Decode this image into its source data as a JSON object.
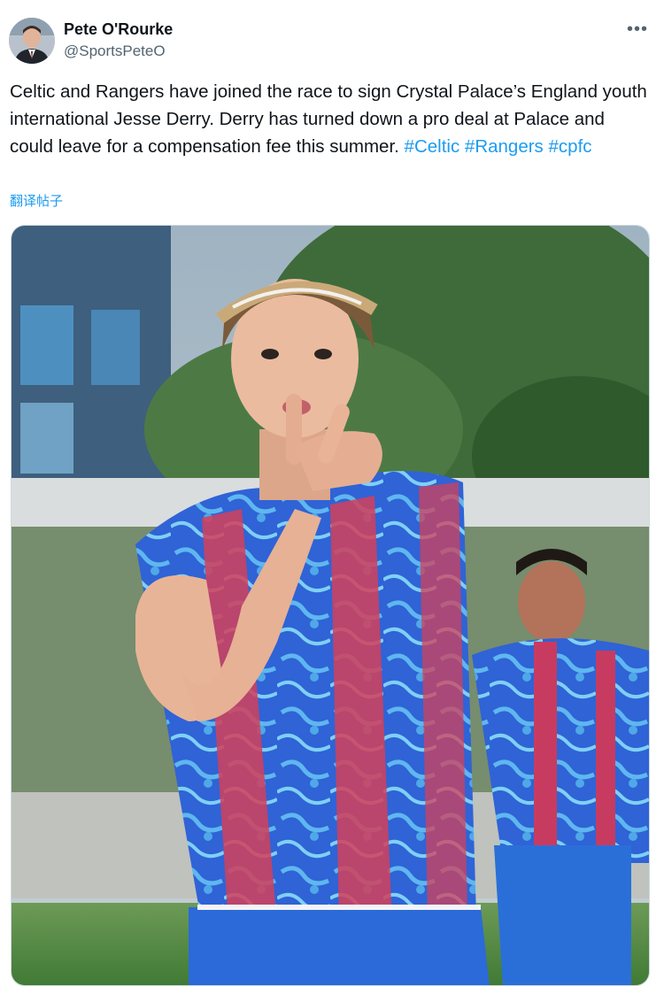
{
  "author": {
    "display_name": "Pete O'Rourke",
    "handle": "@SportsPeteO",
    "avatar_icon": "user-avatar"
  },
  "more_icon": "more-horizontal-icon",
  "more_glyph": "•••",
  "tweet": {
    "text": "Celtic and Rangers have joined the race to sign Crystal Palace’s England youth international Jesse Derry. Derry has turned down a pro deal at Palace and could leave for a compensation fee this summer.",
    "hashtags": [
      "#Celtic",
      "#Rangers",
      "#cpfc"
    ]
  },
  "translate_label": "翻译帖子",
  "colors": {
    "accent": "#1d9bf0",
    "text": "#0f1419",
    "secondary": "#536471"
  }
}
